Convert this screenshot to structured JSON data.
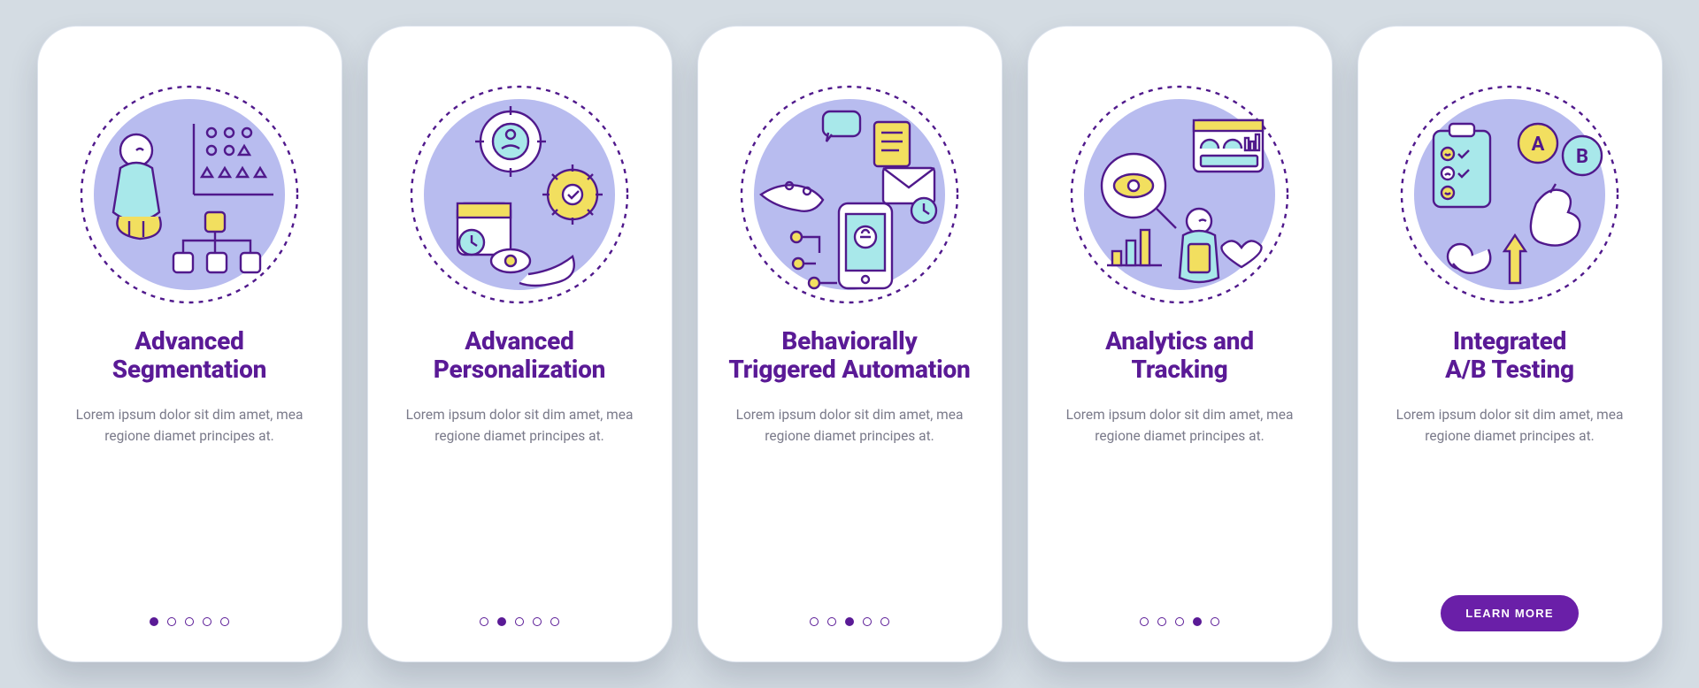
{
  "cards": [
    {
      "title_l1": "Advanced",
      "title_l2": "Segmentation",
      "body": "Lorem ipsum dolor sit dim amet, mea regione diamet principes at.",
      "active_dot": 0,
      "icon": "segmentation-icon"
    },
    {
      "title_l1": "Advanced",
      "title_l2": "Personalization",
      "body": "Lorem ipsum dolor sit dim amet, mea regione diamet principes at.",
      "active_dot": 1,
      "icon": "personalization-icon"
    },
    {
      "title_l1": "Behaviorally",
      "title_l2": "Triggered Automation",
      "body": "Lorem ipsum dolor sit dim amet, mea regione diamet principes at.",
      "active_dot": 2,
      "icon": "automation-icon"
    },
    {
      "title_l1": "Analytics and",
      "title_l2": "Tracking",
      "body": "Lorem ipsum dolor sit dim amet, mea regione diamet principes at.",
      "active_dot": 3,
      "icon": "analytics-icon"
    },
    {
      "title_l1": "Integrated",
      "title_l2": "A/B Testing",
      "body": "Lorem ipsum dolor sit dim amet, mea regione diamet principes at.",
      "active_dot": 4,
      "icon": "ab-testing-icon"
    }
  ],
  "learn_more_label": "LEARN MORE",
  "colors": {
    "purple": "#5a1a96",
    "yellow": "#f2df5f",
    "cyan": "#a8e8ea",
    "lavender": "#b8bcef",
    "bg": "#d4dce3"
  }
}
